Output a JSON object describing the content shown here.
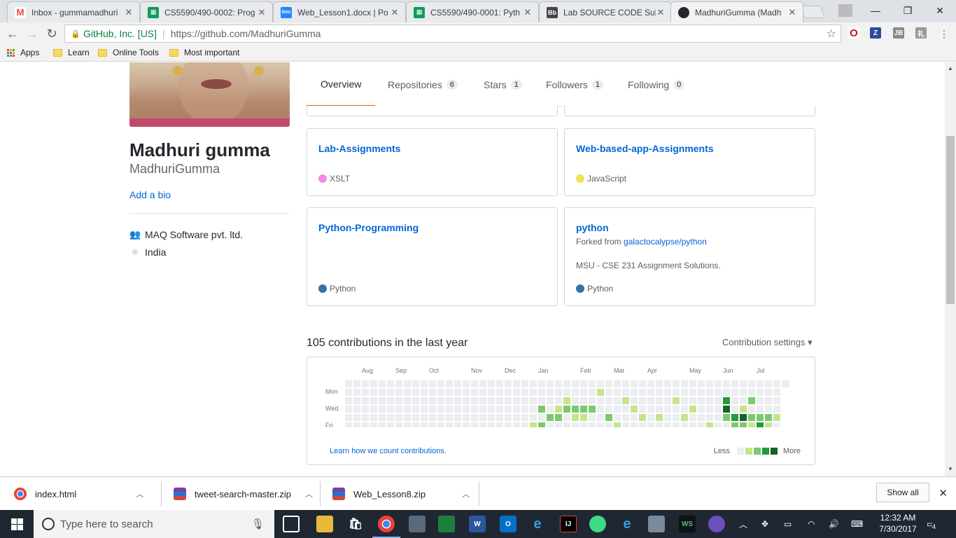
{
  "browser": {
    "tabs": [
      {
        "title": "Inbox - gummamadhuri",
        "icon": "gmail-icon",
        "color": "#ea4335",
        "glyph": "M"
      },
      {
        "title": "CS5590/490-0002: Prog",
        "icon": "sheets-icon",
        "color": "#0f9d58",
        "glyph": "▦"
      },
      {
        "title": "Web_Lesson1.docx | Po",
        "icon": "box-icon",
        "color": "#2486fc",
        "glyph": "box"
      },
      {
        "title": "CS5590/490-0001: Pyth",
        "icon": "sheets-icon",
        "color": "#0f9d58",
        "glyph": "▦"
      },
      {
        "title": "Lab SOURCE CODE Sub",
        "icon": "blackboard-icon",
        "color": "#444444",
        "glyph": "Bb"
      },
      {
        "title": "MadhuriGumma (Madh",
        "icon": "github-icon",
        "color": "#24292e",
        "glyph": "●"
      }
    ],
    "address": {
      "org": "GitHub, Inc. [US]",
      "url": "https://github.com/MadhuriGumma"
    },
    "bookmarks": [
      "Apps",
      "Learn",
      "Online Tools",
      "Most important"
    ]
  },
  "profile": {
    "fullname": "Madhuri gumma",
    "username": "MadhuriGumma",
    "add_bio": "Add a bio",
    "company": "MAQ Software pvt. ltd.",
    "location": "India"
  },
  "navtabs": [
    {
      "label": "Overview",
      "count": null
    },
    {
      "label": "Repositories",
      "count": "6"
    },
    {
      "label": "Stars",
      "count": "1"
    },
    {
      "label": "Followers",
      "count": "1"
    },
    {
      "label": "Following",
      "count": "0"
    }
  ],
  "repos": [
    {
      "name": "Lab-Assignments",
      "fork_prefix": "",
      "fork_link": "",
      "description": "",
      "language": "XSLT",
      "lang_color": "#eb8ceb"
    },
    {
      "name": "Web-based-app-Assignments",
      "fork_prefix": "",
      "fork_link": "",
      "description": "",
      "language": "JavaScript",
      "lang_color": "#f1e05a"
    },
    {
      "name": "Python-Programming",
      "fork_prefix": "",
      "fork_link": "",
      "description": "",
      "language": "Python",
      "lang_color": "#3572a5"
    },
    {
      "name": "python",
      "fork_prefix": "Forked from ",
      "fork_link": "galactocalypse/python",
      "description": "MSU - CSE 231 Assignment Solutions.",
      "language": "Python",
      "lang_color": "#3572a5"
    }
  ],
  "contributions": {
    "title": "105 contributions in the last year",
    "settings": "Contribution settings ▾",
    "months": [
      "Aug",
      "Sep",
      "Oct",
      "Nov",
      "Dec",
      "Jan",
      "Feb",
      "Mar",
      "Apr",
      "May",
      "Jun",
      "Jul"
    ],
    "weekdays": [
      "Mon",
      "Wed",
      "Fri"
    ],
    "learn_link": "Learn how we count contributions.",
    "legend_less": "Less",
    "legend_more": "More",
    "level_colors": [
      "#ebedf0",
      "#c6e48b",
      "#7bc96f",
      "#239a3b",
      "#196127"
    ]
  },
  "downloads": {
    "items": [
      {
        "name": "index.html",
        "icon": "chrome-file-icon"
      },
      {
        "name": "tweet-search-master.zip",
        "icon": "winrar-icon"
      },
      {
        "name": "Web_Lesson8.zip",
        "icon": "winrar-icon"
      }
    ],
    "show_all": "Show all"
  },
  "taskbar": {
    "search_placeholder": "Type here to search",
    "time": "12:32 AM",
    "date": "7/30/2017",
    "notifications": "4"
  }
}
